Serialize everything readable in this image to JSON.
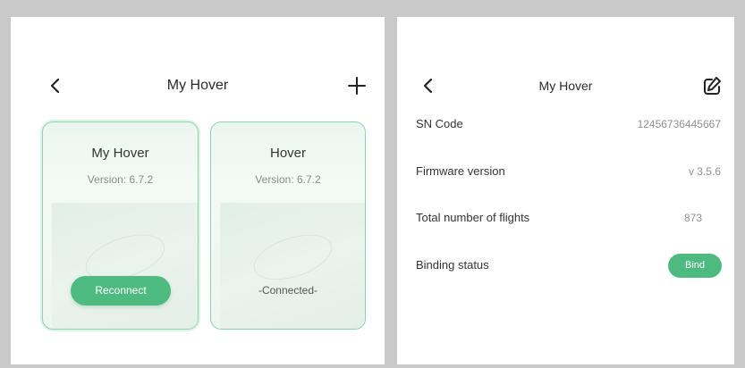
{
  "left": {
    "header": {
      "title": "My Hover"
    },
    "devices": [
      {
        "name": "My Hover",
        "version": "Version: 6.7.2",
        "action_label": "Reconnect"
      },
      {
        "name": "Hover",
        "version": "Version: 6.7.2",
        "status": "-Connected-"
      }
    ]
  },
  "right": {
    "header": {
      "title": "My Hover"
    },
    "details": [
      {
        "label": "SN Code",
        "value": "12456736445667"
      },
      {
        "label": "Firmware version",
        "value": "v 3.5.6"
      },
      {
        "label": "Total number of flights",
        "value": "873"
      },
      {
        "label": "Binding status",
        "action_label": "Bind"
      }
    ]
  },
  "colors": {
    "accent": "#4dbb7f",
    "card_border": "#8fd3ad",
    "frame": "#c9c9c9"
  },
  "icons": {
    "back": "chevron-left-icon",
    "add": "plus-icon",
    "edit": "edit-icon"
  }
}
